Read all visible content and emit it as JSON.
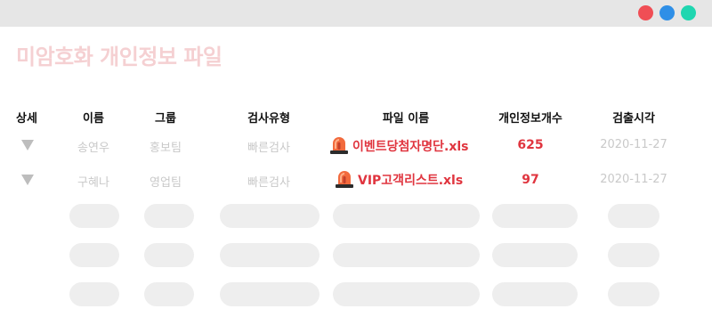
{
  "window": {
    "controls": [
      {
        "name": "close",
        "color": "#f04e55"
      },
      {
        "name": "minimize",
        "color": "#2f8fe7"
      },
      {
        "name": "maximize",
        "color": "#1fd6b0"
      }
    ]
  },
  "title": {
    "text": "미암호화 개인정보 파일",
    "color": "#f5d0d2"
  },
  "table": {
    "headers": {
      "detail": "상세",
      "name": "이름",
      "group": "그룹",
      "scan_type": "검사유형",
      "file_name": "파일 이름",
      "pii_count": "개인정보개수",
      "detect_time": "검출시각"
    },
    "rows": [
      {
        "name": "송연우",
        "group": "홍보팀",
        "scan_type": "빠른검사",
        "file_name": "이벤트당첨자명단.xls",
        "pii_count": "625",
        "detect_time": "2020-11-27",
        "file_icon": "siren-icon"
      },
      {
        "name": "구혜나",
        "group": "영업팀",
        "scan_type": "빠른검사",
        "file_name": "VIP고객리스트.xls",
        "pii_count": "97",
        "detect_time": "2020-11-27",
        "file_icon": "siren-icon"
      }
    ],
    "placeholder_rows": 3
  },
  "colors": {
    "accent": "#e0353f",
    "muted_text": "#c9c9c9",
    "skeleton": "#eeeeee",
    "titlebar": "#e6e6e6"
  }
}
